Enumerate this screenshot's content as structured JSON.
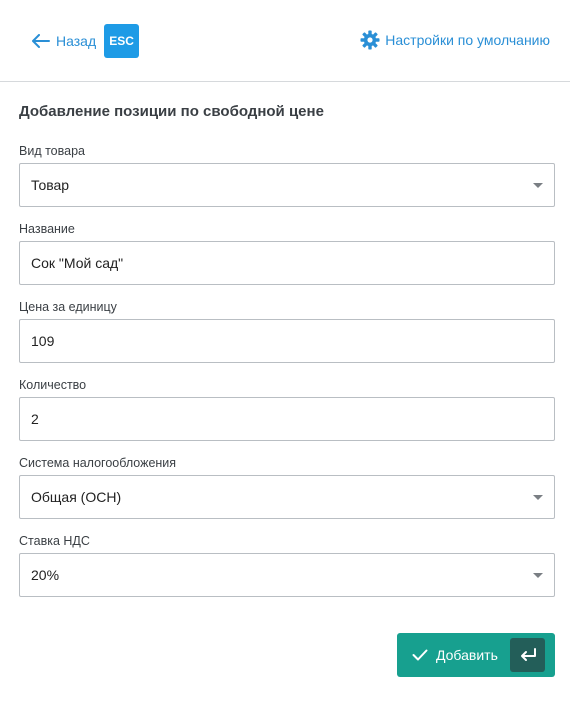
{
  "header": {
    "back_label": "Назад",
    "esc_badge": "ESC",
    "settings_label": "Настройки по умолчанию",
    "back_icon": "arrow-left-icon",
    "settings_icon": "gear-icon"
  },
  "form": {
    "title": "Добавление позиции по свободной цене",
    "product_type": {
      "label": "Вид товара",
      "value": "Товар"
    },
    "name": {
      "label": "Название",
      "value": "Сок \"Мой сад\""
    },
    "unit_price": {
      "label": "Цена за единицу",
      "value": "109"
    },
    "quantity": {
      "label": "Количество",
      "value": "2"
    },
    "tax_system": {
      "label": "Система налогообложения",
      "value": "Общая (ОСН)"
    },
    "vat_rate": {
      "label": "Ставка НДС",
      "value": "20%"
    }
  },
  "actions": {
    "add_label": "Добавить",
    "add_icon": "checkmark-icon",
    "enter_icon": "enter-key-icon"
  },
  "colors": {
    "link": "#2a8fd6",
    "badge": "#1e9be6",
    "primary_button": "#17a08f",
    "enter_key": "#235e59"
  }
}
